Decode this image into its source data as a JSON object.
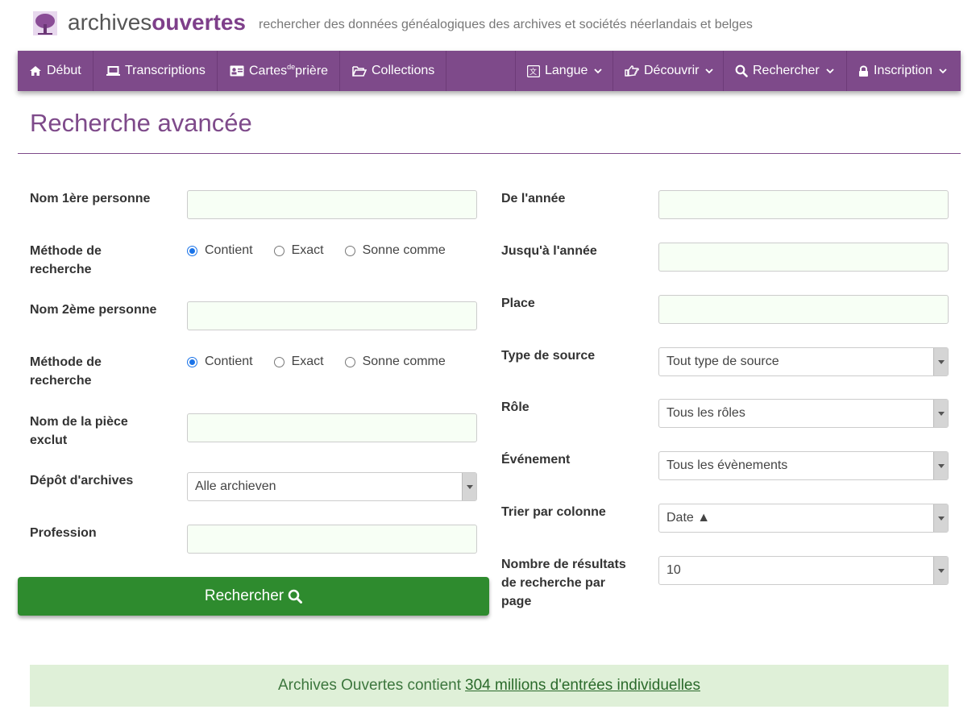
{
  "header": {
    "logo_part1": "archives",
    "logo_part2": "ouvertes",
    "tagline": "rechercher des données généalogiques des archives et sociétés néerlandais et belges"
  },
  "nav": {
    "home": "Début",
    "transcriptions": "Transcriptions",
    "cards_prefix": "Cartes",
    "cards_sup": "de",
    "cards_suffix": "prière",
    "collections": "Collections",
    "language": "Langue",
    "discover": "Découvrir",
    "search": "Rechercher",
    "login": "Inscription"
  },
  "page": {
    "title": "Recherche avancée"
  },
  "form": {
    "name1_label": "Nom 1ère personne",
    "method_label_1": "Méthode de",
    "method_label_2": "recherche",
    "method_options": [
      "Contient",
      "Exact",
      "Sonne comme"
    ],
    "method1_selected": "Contient",
    "name2_label": "Nom 2ème personne",
    "method2_selected": "Contient",
    "exclude_label_1": "Nom de la pièce",
    "exclude_label_2": "exclut",
    "archive_label": "Dépôt d'archives",
    "archive_value": "Alle archieven",
    "profession_label": "Profession",
    "from_year_label": "De l'année",
    "to_year_label": "Jusqu'à l'année",
    "place_label": "Place",
    "source_type_label": "Type de source",
    "source_type_value": "Tout type de source",
    "role_label": "Rôle",
    "role_value": "Tous les rôles",
    "event_label": "Événement",
    "event_value": "Tous les évènements",
    "sort_label": "Trier par colonne",
    "sort_value": "Date ▲",
    "results_label_1": "Nombre de résultats",
    "results_label_2": "de recherche par",
    "results_label_3": "page",
    "results_value": "10",
    "submit_label": "Rechercher"
  },
  "info": {
    "prefix": "Archives Ouvertes contient",
    "link": "304 millions d'entrées individuelles"
  },
  "colors": {
    "brand_purple": "#7e4a8a",
    "button_green": "#2e8b2e",
    "info_bg": "#dff0d8"
  }
}
